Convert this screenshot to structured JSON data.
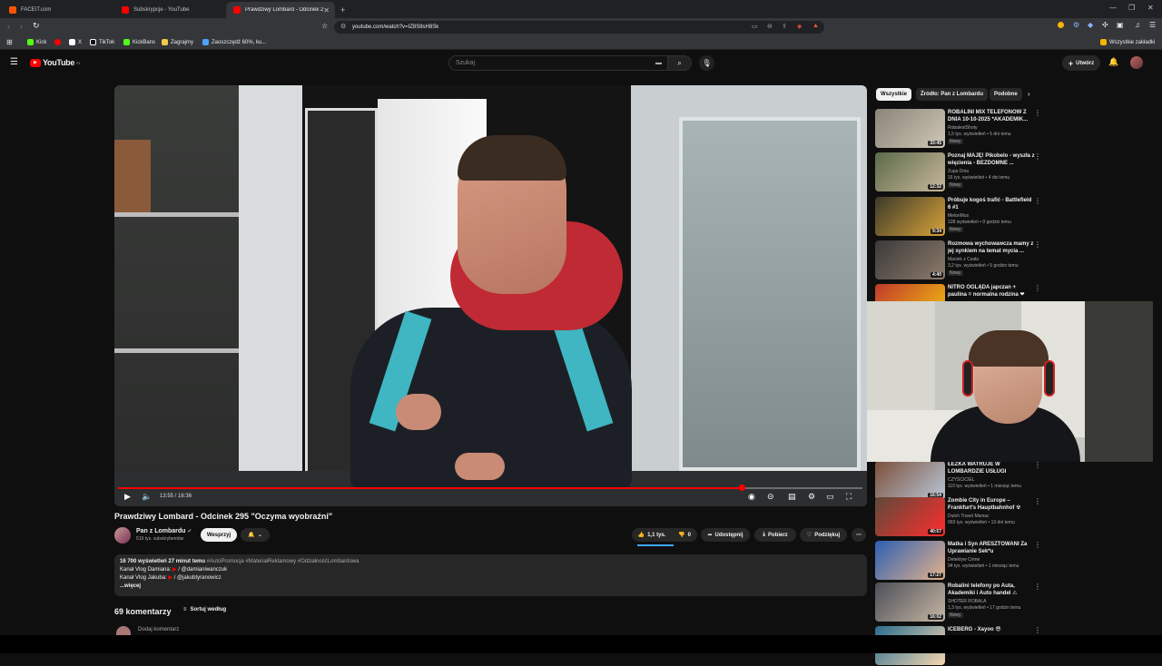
{
  "browser": {
    "tabs": [
      {
        "label": "FACEIT.com",
        "color": "#ff5500"
      },
      {
        "label": "Subskrypcje - YouTube",
        "color": "#ff0000"
      },
      {
        "label": "Prawdziwy Lombard - Odcinek 2",
        "color": "#ff0000"
      }
    ],
    "new_tab": "+",
    "url": "youtube.com/watch?v=IZ8S8sH8Sk",
    "bookmarks": [
      {
        "label": "Kick",
        "color": "#53fc18"
      },
      {
        "label": "",
        "color": "#ff0000"
      },
      {
        "label": "X",
        "color": "#ffffff"
      },
      {
        "label": "TikTok",
        "color": "#ffffff"
      },
      {
        "label": "KickBans",
        "color": "#53fc18"
      },
      {
        "label": "Zagrajmy",
        "color": "#f7c948"
      },
      {
        "label": "Zaoszczędź 60%, ku...",
        "color": "#4da3ff"
      }
    ],
    "all_bookmarks": "Wszystkie zakładki"
  },
  "youtube": {
    "logo": "YouTube",
    "logo_sup": "PL",
    "search_placeholder": "Szukaj",
    "create_label": "Utwórz"
  },
  "player": {
    "time": "13:55 / 16:36",
    "progress": 0.838
  },
  "video": {
    "title": "Prawdziwy Lombard - Odcinek 295 \"Oczyma wyobraźni\"",
    "channel": "Pan z Lombardu",
    "subs": "519 tys. subskrybentów",
    "support": "Wesprzyj",
    "likes": "1,1 tys.",
    "dislikes": "0",
    "share": "Udostępnij",
    "download": "Pobierz",
    "thanks": "Podziękuj",
    "views": "16 700 wyświetleń  27 minut temu",
    "hashtags": "#AutoPromocja #MateriałReklamowy #OdziałnośćLombardowa",
    "line1_label": "Kanał Vlog Damiana:",
    "line1_link": "/ @damianiwanczuk",
    "line2_label": "Kanał Vlog Jakuba:",
    "line2_link": "/ @jakubtyranowicz",
    "more": "...więcej"
  },
  "comments": {
    "count": "69 komentarzy",
    "sort": "Sortuj według",
    "add": "Dodaj komentarz"
  },
  "chips": [
    "Wszystkie",
    "Źródło: Pan z Lombardu",
    "Podobne"
  ],
  "recs": [
    {
      "title": "ROBALINI MIX TELEFONÓW Z DNIA 10-10-2025 *AKADEMIK...",
      "channel": "RobalestShoty",
      "meta": "1,5 tys. wyświetleń • 5 dni temu",
      "badge": "Nowy",
      "dur": "33:45",
      "c1": "#8a8478",
      "c2": "#cfc6b5"
    },
    {
      "title": "Poznaj MAJĘ! Pikobelo - wyszła z więzienia - BEZDOMNE ...",
      "channel": "Zupa Dnia",
      "meta": "16 tys. wyświetleń • 4 dni temu",
      "badge": "Nowy",
      "dur": "12:32",
      "c1": "#5a6b4a",
      "c2": "#c9b79a"
    },
    {
      "title": "Próbuje kogoś trafić - Battlefield 6 #1",
      "channel": "MelonMus",
      "meta": "128 wyświetleń • 9 godzin temu",
      "badge": "Nowy",
      "dur": "9:34",
      "c1": "#3b3a2a",
      "c2": "#d8a23a"
    },
    {
      "title": "Rozmowa wychowawcza mamy z jej synkiem na temat mycia ...",
      "channel": "Maciek z Czatu",
      "meta": "3,2 tys. wyświetleń • 5 godzin temu",
      "badge": "Nowy",
      "dur": "4:40",
      "c1": "#3a3a3a",
      "c2": "#8d7b6a"
    },
    {
      "title": "NITRO OGLĄDA japczan + paulina = normalna rodzina ❤",
      "channel": "",
      "meta": "",
      "badge": "",
      "dur": "",
      "c1": "#c0392b",
      "c2": "#f1c40f"
    },
    {
      "title": "ŁEZKA WATRUJE W LOMBARDZIE USŁUGI",
      "channel": "CZYŚCICIEL",
      "meta": "110 tys. wyświetleń • 1 miesiąc temu",
      "badge": "",
      "dur": "16:54",
      "c1": "#7c4f3a",
      "c2": "#b8c7d8"
    },
    {
      "title": "Zombie City in Europe – Frankfurt's Hauptbahnhof ☢",
      "channel": "Dutch Travel Maniac",
      "meta": "993 tys. wyświetleń • 13 dni temu",
      "badge": "",
      "dur": "40:57",
      "c1": "#5d4a3a",
      "c2": "#ff2d2d"
    },
    {
      "title": "Matka i Syn ARESZTOWANI Za Uprawianie Sek*u",
      "channel": "Detektyw Crime",
      "meta": "94 tys. wyświetleń • 1 miesiąc temu",
      "badge": "",
      "dur": "17:27",
      "c1": "#2d5fb3",
      "c2": "#e3b28a"
    },
    {
      "title": "Robalini telefony po Auta, Akademiki i Auto handel ⚠",
      "channel": "SHOTER ROBALA",
      "meta": "1,3 tys. wyświetleń • 17 godzin temu",
      "badge": "Nowy",
      "dur": "16:02",
      "c1": "#4b4f58",
      "c2": "#c7b6a3"
    },
    {
      "title": "ICEBERG - Xayoo 😎",
      "channel": "",
      "meta": "",
      "badge": "",
      "dur": "",
      "c1": "#2b6c8f",
      "c2": "#f6d7b0"
    }
  ]
}
